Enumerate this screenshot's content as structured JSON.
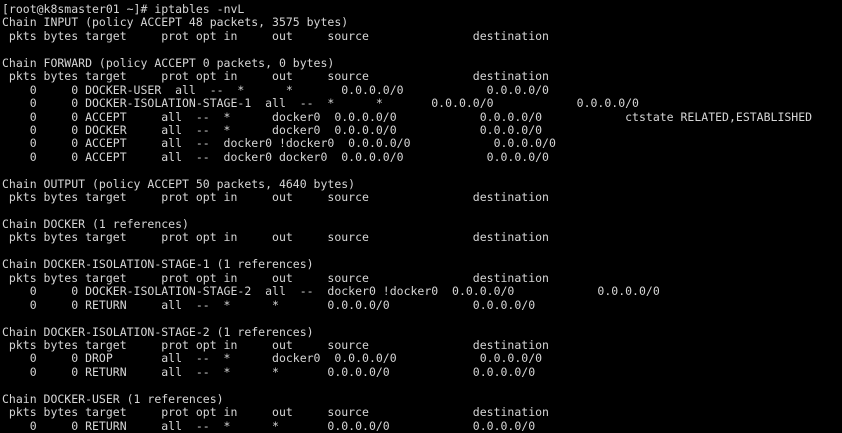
{
  "terminal": {
    "prompt": "[root@k8smaster01 ~]# ",
    "command": "iptables -nvL",
    "output": [
      "Chain INPUT (policy ACCEPT 48 packets, 3575 bytes)",
      " pkts bytes target     prot opt in     out     source               destination",
      "",
      "Chain FORWARD (policy ACCEPT 0 packets, 0 bytes)",
      " pkts bytes target     prot opt in     out     source               destination",
      "    0     0 DOCKER-USER  all  --  *      *       0.0.0.0/0            0.0.0.0/0",
      "    0     0 DOCKER-ISOLATION-STAGE-1  all  --  *      *       0.0.0.0/0            0.0.0.0/0",
      "    0     0 ACCEPT     all  --  *      docker0  0.0.0.0/0            0.0.0.0/0            ctstate RELATED,ESTABLISHED",
      "    0     0 DOCKER     all  --  *      docker0  0.0.0.0/0            0.0.0.0/0",
      "    0     0 ACCEPT     all  --  docker0 !docker0  0.0.0.0/0            0.0.0.0/0",
      "    0     0 ACCEPT     all  --  docker0 docker0  0.0.0.0/0            0.0.0.0/0",
      "",
      "Chain OUTPUT (policy ACCEPT 50 packets, 4640 bytes)",
      " pkts bytes target     prot opt in     out     source               destination",
      "",
      "Chain DOCKER (1 references)",
      " pkts bytes target     prot opt in     out     source               destination",
      "",
      "Chain DOCKER-ISOLATION-STAGE-1 (1 references)",
      " pkts bytes target     prot opt in     out     source               destination",
      "    0     0 DOCKER-ISOLATION-STAGE-2  all  --  docker0 !docker0  0.0.0.0/0            0.0.0.0/0",
      "    0     0 RETURN     all  --  *      *       0.0.0.0/0            0.0.0.0/0",
      "",
      "Chain DOCKER-ISOLATION-STAGE-2 (1 references)",
      " pkts bytes target     prot opt in     out     source               destination",
      "    0     0 DROP       all  --  *      docker0  0.0.0.0/0            0.0.0.0/0",
      "    0     0 RETURN     all  --  *      *       0.0.0.0/0            0.0.0.0/0",
      "",
      "Chain DOCKER-USER (1 references)",
      " pkts bytes target     prot opt in     out     source               destination",
      "    0     0 RETURN     all  --  *      *       0.0.0.0/0            0.0.0.0/0"
    ]
  },
  "colors": {
    "background": "#000000",
    "foreground": "#d6d6d6"
  }
}
